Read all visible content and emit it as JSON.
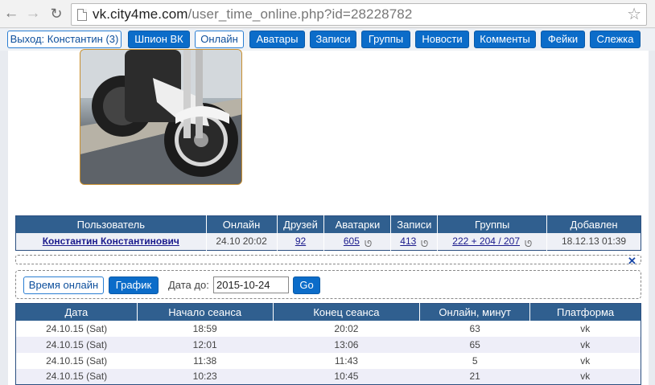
{
  "browser": {
    "url_host": "vk.city4me.com",
    "url_path": "/user_time_online.php?id=28228782",
    "icons": {
      "back": "back-arrow-icon",
      "forward": "forward-arrow-icon",
      "reload": "reload-icon",
      "page": "page-icon",
      "bookmark": "star-icon"
    }
  },
  "nav": {
    "logout": "Выход: Константин (3)",
    "spy": "Шпион ВК",
    "online": "Онлайн",
    "avatars": "Аватары",
    "posts": "Записи",
    "groups": "Группы",
    "news": "Новости",
    "comments": "Комменты",
    "fakes": "Фейки",
    "tracking": "Слежка"
  },
  "user_table": {
    "headers": [
      "Пользователь",
      "Онлайн",
      "Друзей",
      "Аватарки",
      "Записи",
      "Группы",
      "Добавлен"
    ],
    "row": {
      "name": "Константин Константинович",
      "online": "24.10 20:02",
      "friends": "92",
      "avatars": "605",
      "posts": "413",
      "groups": "222 + 204 / 207",
      "added": "18.12.13 01:39"
    }
  },
  "close_label": "✕",
  "controls": {
    "time_online": "Время онлайн",
    "graph": "График",
    "date_label": "Дата до:",
    "date_value": "2015-10-24",
    "go": "Go"
  },
  "sessions": {
    "headers": [
      "Дата",
      "Начало сеанса",
      "Конец сеанса",
      "Онлайн, минут",
      "Платформа"
    ],
    "rows": [
      [
        "24.10.15 (Sat)",
        "18:59",
        "20:02",
        "63",
        "vk"
      ],
      [
        "24.10.15 (Sat)",
        "12:01",
        "13:06",
        "65",
        "vk"
      ],
      [
        "24.10.15 (Sat)",
        "11:38",
        "11:43",
        "5",
        "vk"
      ],
      [
        "24.10.15 (Sat)",
        "10:23",
        "10:45",
        "21",
        "vk"
      ]
    ]
  },
  "colors": {
    "accent": "#0b6cc9",
    "header": "#305f8f",
    "link": "#1a1a8c"
  }
}
